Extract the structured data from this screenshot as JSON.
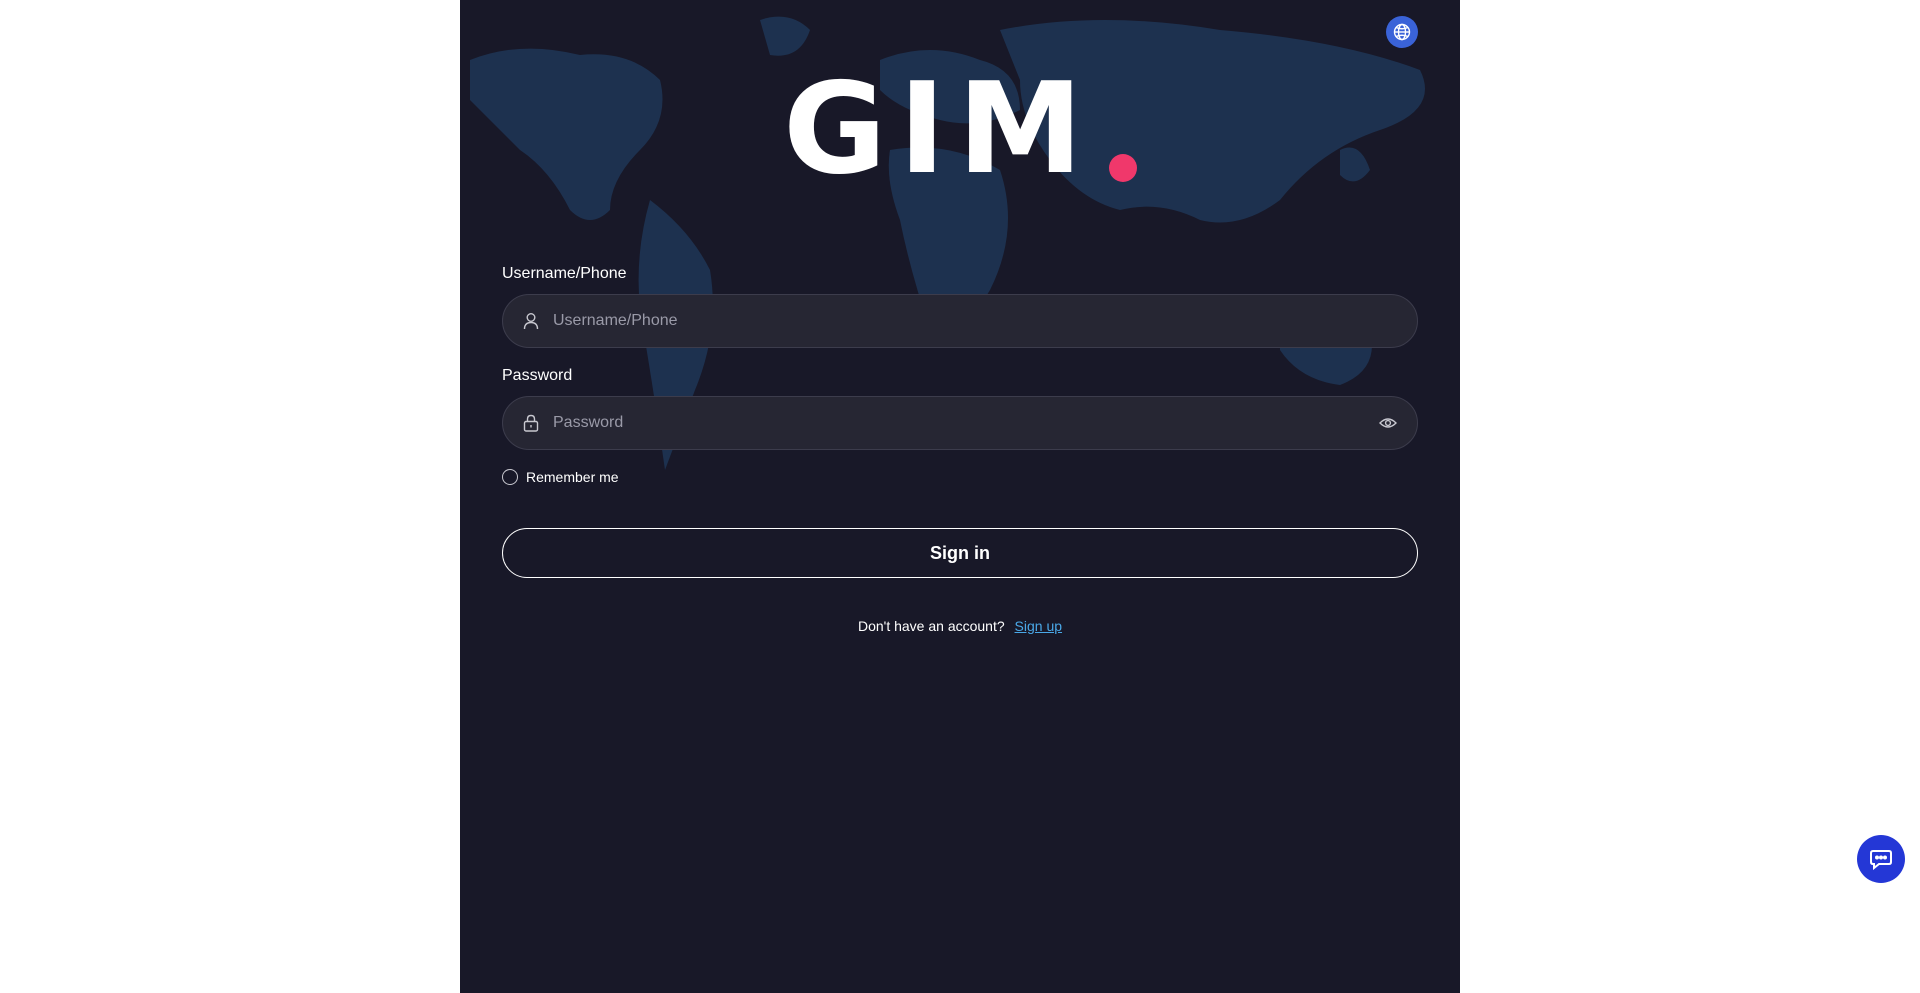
{
  "header": {
    "language_icon": "globe-icon",
    "accent_color": "#3a63d8"
  },
  "logo": {
    "text": "GIM",
    "dot_color": "#f0386b"
  },
  "form": {
    "username": {
      "label": "Username/Phone",
      "placeholder": "Username/Phone",
      "value": "",
      "icon": "user-icon"
    },
    "password": {
      "label": "Password",
      "placeholder": "Password",
      "value": "",
      "icon": "lock-icon",
      "toggle_icon": "eye-icon"
    },
    "remember_label": "Remember me",
    "signin_label": "Sign in",
    "signup_prompt": "Don't have an account?",
    "signup_link": "Sign up"
  },
  "chat": {
    "icon": "chat-icon",
    "color": "#2437d6"
  }
}
